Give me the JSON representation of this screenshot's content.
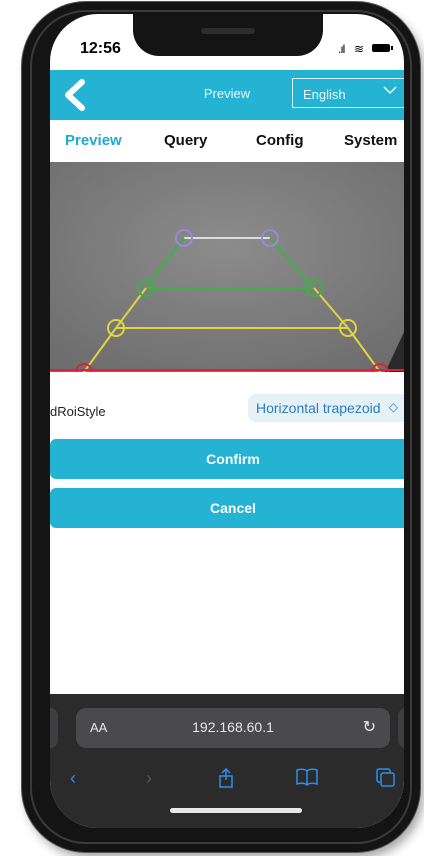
{
  "status": {
    "time": "12:56",
    "signal": ".ıl",
    "wifi": "≋"
  },
  "navbar": {
    "title": "Preview",
    "language": "English"
  },
  "tabs": [
    {
      "label": "Preview",
      "active": true
    },
    {
      "label": "Query",
      "active": false
    },
    {
      "label": "Config",
      "active": false
    },
    {
      "label": "System",
      "active": false
    }
  ],
  "form": {
    "roi_label": "dRoiStyle",
    "roi_value": "Horizontal trapezoid"
  },
  "buttons": {
    "confirm": "Confirm",
    "cancel": "Cancel"
  },
  "browser": {
    "aa": "AA",
    "url": "192.168.60.1"
  },
  "colors": {
    "accent": "#24b3d3",
    "purple": "#9b88d8",
    "green": "#3bb244",
    "yellow": "#e0d440"
  }
}
